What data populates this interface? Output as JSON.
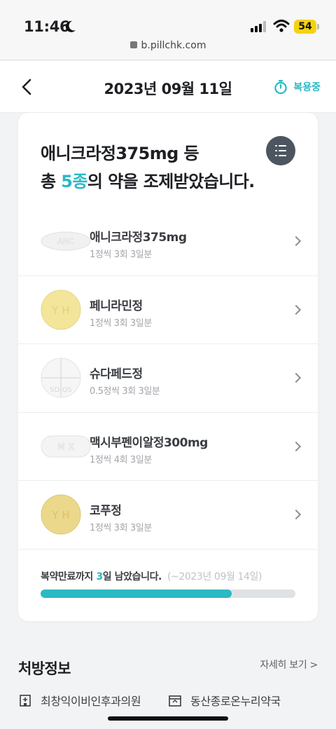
{
  "status_bar": {
    "time": "11:46",
    "battery": "54"
  },
  "browser": {
    "url": "b.pillchk.com"
  },
  "header": {
    "title": "2023년 09월 11일",
    "status_label": "복용중"
  },
  "summary": {
    "line1": "애니크라정375mg 등",
    "line2_prefix": "총 ",
    "count": "5종",
    "line2_suffix": "의 약을 조제받았습니다."
  },
  "medications": [
    {
      "name": "애니크라정375mg",
      "dose": "1정씩 3회 3일분",
      "imprint": "ANC",
      "shape": "oval",
      "color": "#f1f1f1"
    },
    {
      "name": "페니라민정",
      "dose": "1정씩 3회 3일분",
      "imprint": "Y H",
      "shape": "round",
      "color": "#f3e59a"
    },
    {
      "name": "슈다페드정",
      "dose": "0.5정씩 3회 3일분",
      "imprint": "SD QS",
      "shape": "round-scored",
      "color": "#f6f6f6"
    },
    {
      "name": "맥시부펜이알정300mg",
      "dose": "1정씩 4회 3일분",
      "imprint": "M X",
      "shape": "oval",
      "color": "#f4f4f4"
    },
    {
      "name": "코푸정",
      "dose": "1정씩 3회 3일분",
      "imprint": "Y H",
      "shape": "round",
      "color": "#ecd88a"
    }
  ],
  "progress": {
    "text_prefix": "복약만료까지 ",
    "days": "3",
    "text_suffix": "일 남았습니다.",
    "end_date": "(~2023년 09월 14일)",
    "fraction": 0.75
  },
  "prescription": {
    "title": "처방정보",
    "more_label": "자세히 보기 >",
    "hospital": "최창익이비인후과의원",
    "pharmacy": "동산종로온누리약국"
  },
  "colors": {
    "accent": "#2bb9c3",
    "progress_track": "#dfe2e4"
  }
}
